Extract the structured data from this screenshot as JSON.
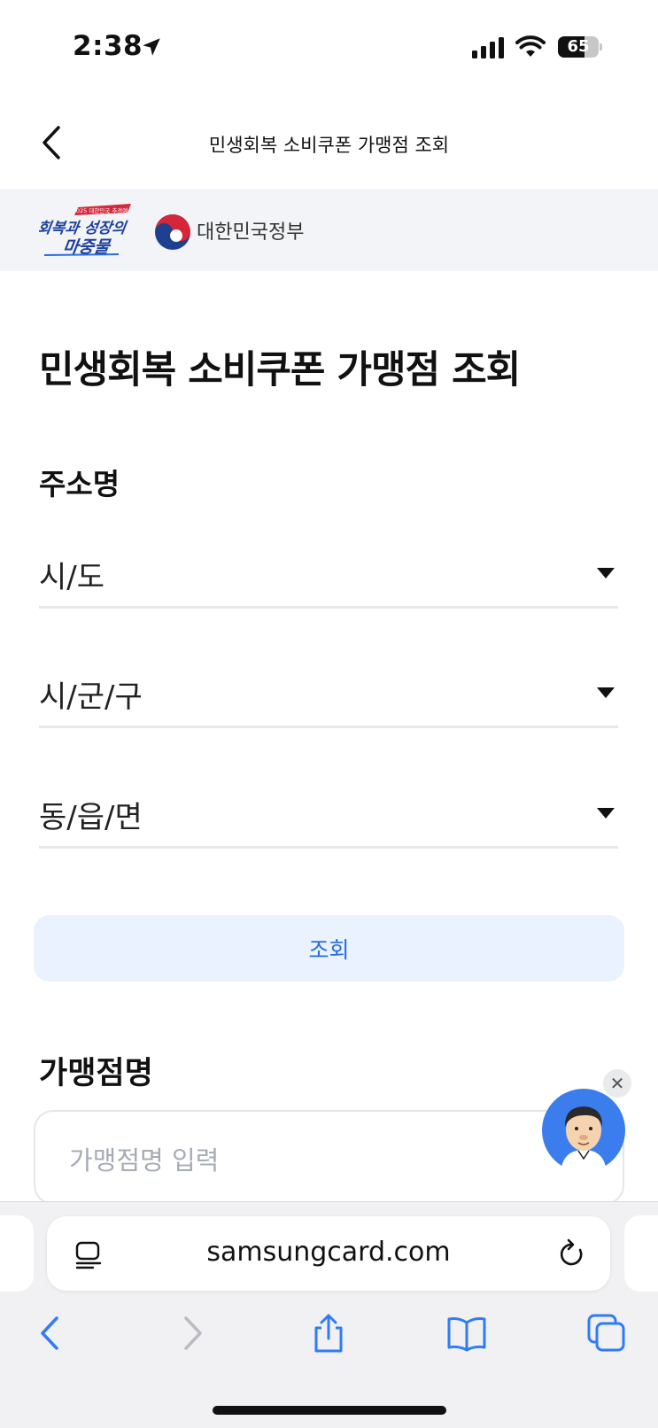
{
  "status_bar": {
    "time": "2:38",
    "battery_level": "65"
  },
  "header": {
    "title": "민생회복 소비쿠폰 가맹점 조회"
  },
  "banner": {
    "campaign_logo": {
      "top_text": "2025 대한민국 추경예산",
      "line1": "회복과 성장의",
      "line2": "마중물"
    },
    "gov_name": "대한민국정부"
  },
  "page": {
    "title": "민생회복 소비쿠폰 가맹점 조회",
    "address_label": "주소명",
    "selects": [
      {
        "value": "시/도"
      },
      {
        "value": "시/군/구"
      },
      {
        "value": "동/읍/면"
      }
    ],
    "search_button": "조회",
    "merchant_label": "가맹점명",
    "merchant_placeholder": "가맹점명 입력"
  },
  "chatbot": {
    "close_glyph": "✕"
  },
  "browser": {
    "url": "samsungcard.com"
  },
  "colors": {
    "accent": "#2a6de0",
    "search_button_bg": "#e9f2fe",
    "banner_bg": "#f2f4f7",
    "safari_bg": "#f1f1f3",
    "system_blue": "#2f7cf6"
  },
  "icons": [
    "location-arrow-icon",
    "signal-icon",
    "wifi-icon",
    "battery-icon",
    "chevron-left-icon",
    "caret-down-icon",
    "close-icon",
    "reader-icon",
    "reload-icon",
    "back-icon",
    "forward-icon",
    "share-icon",
    "bookmarks-icon",
    "tabs-icon"
  ]
}
